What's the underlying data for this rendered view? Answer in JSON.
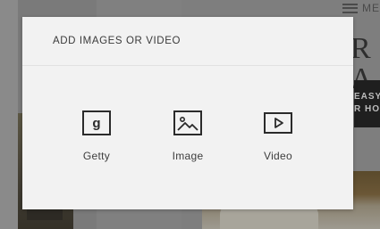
{
  "background": {
    "menu_label": "ME",
    "title_fragment": "R A",
    "banner_lines": [
      "EASY",
      "R HO"
    ]
  },
  "modal": {
    "title": "ADD IMAGES OR VIDEO",
    "options": [
      {
        "label": "Getty",
        "icon": "getty-icon"
      },
      {
        "label": "Image",
        "icon": "image-icon"
      },
      {
        "label": "Video",
        "icon": "video-icon"
      }
    ]
  }
}
